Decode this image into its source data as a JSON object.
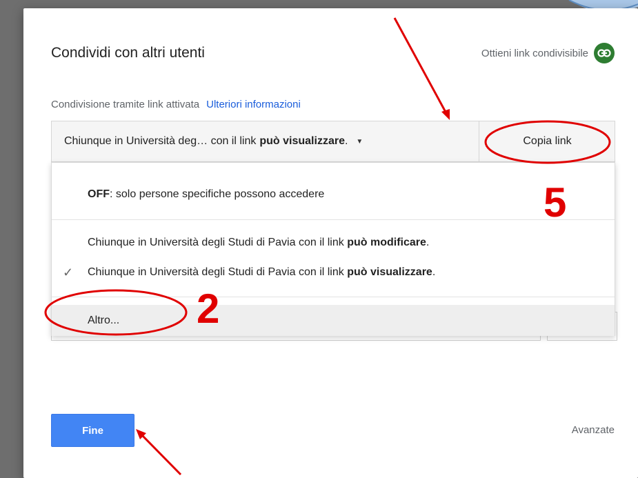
{
  "dialog": {
    "title": "Condividi con altri utenti",
    "get_link_label": "Ottieni link condivisibile",
    "link_icon": "link-icon",
    "status_text": "Condivisione tramite link attivata",
    "learn_more": "Ulteriori informazioni"
  },
  "access": {
    "prefix": "Chiunque in Università deg…  con il link",
    "bold": "può visualizzare",
    "suffix": ".",
    "copy_label": "Copia link"
  },
  "menu": {
    "off_bold": "OFF",
    "off_text": ": solo persone specifiche possono accedere",
    "items": [
      {
        "prefix": "Chiunque in Università degli Studi di Pavia con il link",
        "bold": "può modificare",
        "suffix": "."
      },
      {
        "prefix": "Chiunque in Università degli Studi di Pavia con il link",
        "bold": "può visualizzare",
        "suffix": ".",
        "checked": true
      }
    ],
    "more": "Altro..."
  },
  "footer": {
    "done": "Fine",
    "advanced": "Avanzate"
  },
  "annotations": {
    "step_5": "5",
    "step_2": "2",
    "color": "#e00000"
  }
}
